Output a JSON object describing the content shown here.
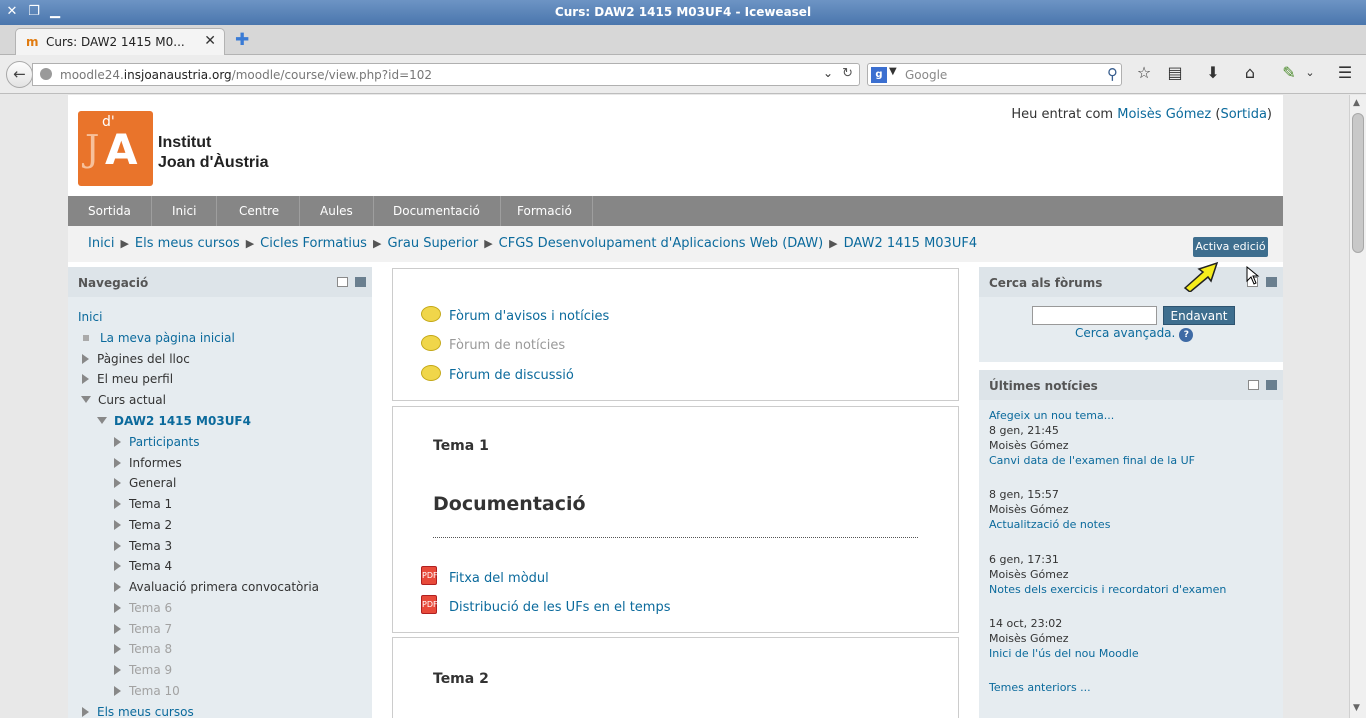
{
  "window": {
    "title": "Curs: DAW2 1415 M03UF4 - Iceweasel"
  },
  "tab": {
    "title": "Curs: DAW2 1415 M0...",
    "close": "✕",
    "new": "✚"
  },
  "nav": {
    "url_host_pre": "moodle24.",
    "url_host": "insjoanaustria.org",
    "url_path": "/moodle/course/view.php?id=102",
    "search_placeholder": "Google"
  },
  "header": {
    "logo_text_1": "Institut",
    "logo_text_2": "Joan d'Àustria",
    "login_prefix": "Heu entrat com ",
    "login_user": "Moisès Gómez",
    "login_open": " (",
    "login_logout": "Sortida",
    "login_close": ")"
  },
  "menu": [
    "Sortida",
    "Inici",
    "Centre",
    "Aules",
    "Documentació",
    "Formació"
  ],
  "breadcrumb": [
    "Inici",
    "Els meus cursos",
    "Cicles Formatius",
    "Grau Superior",
    "CFGS Desenvolupament d'Aplicacions Web (DAW)",
    "DAW2 1415 M03UF4"
  ],
  "edit_button": "Activa edició",
  "navigation": {
    "title": "Navegació",
    "items": [
      {
        "label": "Inici"
      },
      {
        "label": "La meva pàgina inicial"
      },
      {
        "label": "Pàgines del lloc"
      },
      {
        "label": "El meu perfil"
      },
      {
        "label": "Curs actual"
      },
      {
        "label": "DAW2 1415 M03UF4"
      },
      {
        "label": "Participants"
      },
      {
        "label": "Informes"
      },
      {
        "label": "General"
      },
      {
        "label": "Tema 1"
      },
      {
        "label": "Tema 2"
      },
      {
        "label": "Tema 3"
      },
      {
        "label": "Tema 4"
      },
      {
        "label": "Avaluació primera convocatòria"
      },
      {
        "label": "Tema 6"
      },
      {
        "label": "Tema 7"
      },
      {
        "label": "Tema 8"
      },
      {
        "label": "Tema 9"
      },
      {
        "label": "Tema 10"
      },
      {
        "label": "Els meus cursos"
      }
    ]
  },
  "sections": {
    "general": {
      "activities": [
        "Fòrum d'avisos i notícies",
        "Fòrum de notícies",
        "Fòrum de discussió"
      ]
    },
    "tema1": {
      "name": "Tema 1",
      "heading": "Documentació",
      "activities": [
        "Fitxa del mòdul",
        "Distribució de les UFs en el temps"
      ]
    },
    "tema2": {
      "name": "Tema 2"
    }
  },
  "forum_search": {
    "title": "Cerca als fòrums",
    "button": "Endavant",
    "advanced": "Cerca avançada.",
    "help": "?"
  },
  "news": {
    "title": "Últimes notícies",
    "add": "Afegeix un nou tema...",
    "items": [
      {
        "date": "8 gen, 21:45",
        "author": "Moisès Gómez",
        "title": "Canvi data de l'examen final de la UF"
      },
      {
        "date": "8 gen, 15:57",
        "author": "Moisès Gómez",
        "title": "Actualització de notes"
      },
      {
        "date": "6 gen, 17:31",
        "author": "Moisès Gómez",
        "title": "Notes dels exercicis i recordatori d'examen"
      },
      {
        "date": "14 oct, 23:02",
        "author": "Moisès Gómez",
        "title": "Inici de l'ús del nou Moodle"
      }
    ],
    "older": "Temes anteriors ..."
  }
}
